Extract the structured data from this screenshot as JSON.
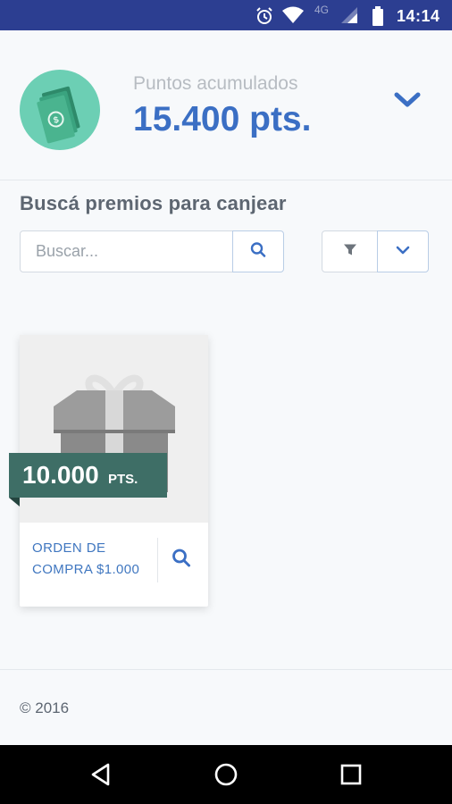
{
  "status_bar": {
    "time": "14:14",
    "network": "4G",
    "icons": [
      "alarm-icon",
      "wifi-icon",
      "signal-icon",
      "battery-icon"
    ]
  },
  "points": {
    "label": "Puntos acumulados",
    "value": "15.400 pts.",
    "avatar_icon": "money-icon",
    "expand_icon": "chevron-down-icon"
  },
  "search_section": {
    "title": "Buscá premios para canjear",
    "search_placeholder": "Buscar...",
    "search_icon": "search-icon",
    "filter_icon": "filter-icon",
    "dropdown_icon": "chevron-down-icon"
  },
  "prizes": [
    {
      "points_number": "10.000",
      "points_unit": "PTS.",
      "name": "ORDEN DE COMPRA $1.000",
      "image_icon": "gift-icon",
      "action_icon": "search-icon"
    }
  ],
  "footer": {
    "copyright": "© 2016"
  },
  "nav_bar": {
    "icons": [
      "back-icon",
      "home-icon",
      "recents-icon"
    ]
  },
  "colors": {
    "status_bar": "#2c3e91",
    "accent": "#3b6fc4",
    "avatar": "#6ccfb4",
    "ribbon": "#3e6e66",
    "background": "#f7f9fb"
  }
}
